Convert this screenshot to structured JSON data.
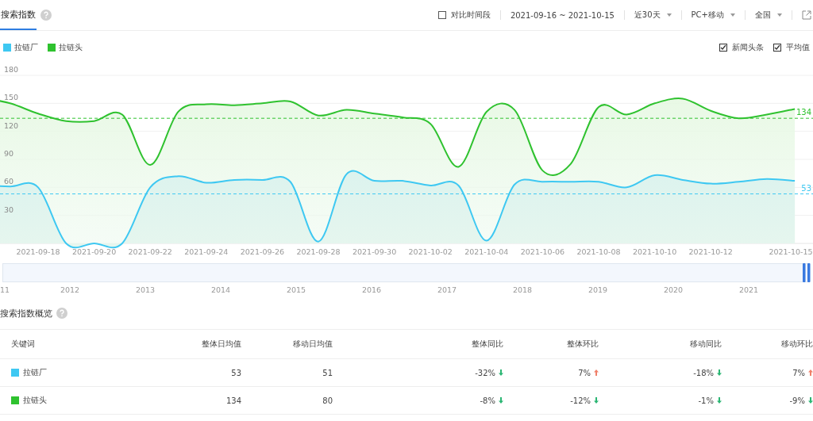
{
  "tabs": [
    {
      "label": "搜索指数",
      "selected": true
    }
  ],
  "toolbar": {
    "compare": {
      "label": "对比时间段",
      "checked": false
    },
    "date_range": "2021-09-16 ~ 2021-10-15",
    "dropdowns": [
      "近30天",
      "PC+移动",
      "全国"
    ]
  },
  "options": [
    {
      "label": "新闻头条",
      "checked": true
    },
    {
      "label": "平均值",
      "checked": true
    }
  ],
  "chart_data": {
    "type": "area",
    "categories": [
      null,
      null,
      "2021-09-18",
      null,
      "2021-09-20",
      null,
      "2021-09-22",
      null,
      "2021-09-24",
      null,
      "2021-09-26",
      null,
      "2021-09-28",
      null,
      "2021-09-30",
      null,
      "2021-10-02",
      null,
      "2021-10-04",
      null,
      "2021-10-06",
      null,
      "2021-10-08",
      null,
      "2021-10-10",
      null,
      "2021-10-12",
      null,
      null,
      "2021-10-15"
    ],
    "series": [
      {
        "name": "拉链厂",
        "color": "#3ec8f2",
        "values": [
          62,
          61,
          60,
          0,
          0,
          0,
          60,
          72,
          65,
          68,
          68,
          66,
          2,
          74,
          67,
          67,
          62,
          62,
          3,
          63,
          66,
          66,
          66,
          60,
          73,
          68,
          64,
          66,
          69,
          67
        ]
      },
      {
        "name": "拉链头",
        "color": "#2fc22f",
        "values": [
          156,
          150,
          139,
          131,
          131,
          138,
          84,
          141,
          149,
          148,
          150,
          152,
          137,
          143,
          139,
          135,
          128,
          82,
          141,
          143,
          78,
          85,
          146,
          138,
          150,
          155,
          142,
          134,
          138,
          144
        ]
      }
    ],
    "ylim": [
      0,
      180
    ],
    "yticks": [
      30,
      60,
      90,
      120,
      150,
      180
    ],
    "grid": true,
    "ref_lines": [
      {
        "axis": "y",
        "value": 53,
        "label": "53",
        "color": "#3ec8f2"
      },
      {
        "axis": "y",
        "value": 134,
        "label": "134",
        "color": "#2fc22f"
      }
    ]
  },
  "navigator": {
    "years": [
      "11",
      "2012",
      "2013",
      "2014",
      "2015",
      "2016",
      "2017",
      "2018",
      "2019",
      "2020",
      "2021"
    ]
  },
  "overview": {
    "title": "搜索指数概览",
    "columns": [
      "关键词",
      "整体日均值",
      "移动日均值",
      "整体同比",
      "整体环比",
      "移动同比",
      "移动环比"
    ],
    "rows": [
      {
        "keyword": "拉链厂",
        "color": "#3ec8f2",
        "overall_avg": "53",
        "mobile_avg": "51",
        "changes": [
          {
            "text": "-32%",
            "kind": "down"
          },
          {
            "text": "7%",
            "kind": "up"
          },
          {
            "text": "-18%",
            "kind": "down"
          },
          {
            "text": "7%",
            "kind": "up"
          }
        ]
      },
      {
        "keyword": "拉链头",
        "color": "#2fc22f",
        "overall_avg": "134",
        "mobile_avg": "80",
        "changes": [
          {
            "text": "-8%",
            "kind": "down"
          },
          {
            "text": "-12%",
            "kind": "down"
          },
          {
            "text": "-1%",
            "kind": "down"
          },
          {
            "text": "-9%",
            "kind": "down"
          }
        ]
      }
    ]
  }
}
